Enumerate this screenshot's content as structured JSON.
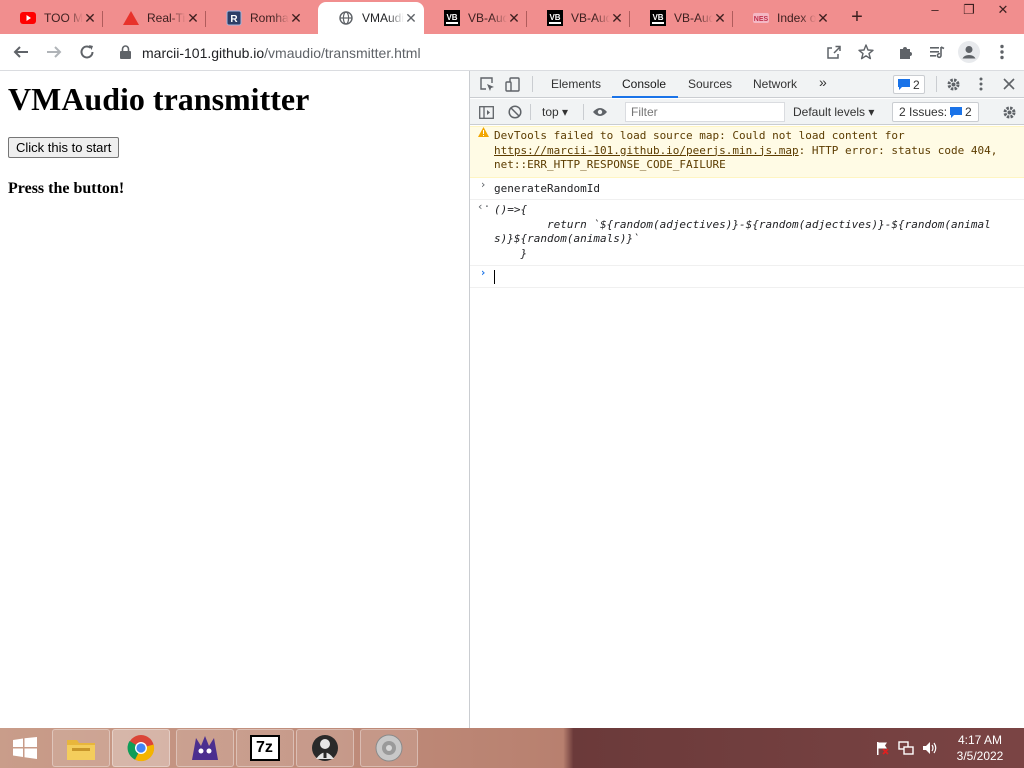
{
  "browser": {
    "tabs": [
      {
        "title": "TOO MUCH",
        "icon": "youtube-icon"
      },
      {
        "title": "Real-Time",
        "icon": "warning-triangle-icon"
      },
      {
        "title": "Romhacks",
        "icon": "r-logo-icon"
      },
      {
        "title": "VMAudio",
        "icon": "globe-icon",
        "active": true
      },
      {
        "title": "VB-Audio",
        "icon": "vb-audio-icon"
      },
      {
        "title": "VB-Audio",
        "icon": "vb-audio-icon"
      },
      {
        "title": "VB-Audio",
        "icon": "vb-audio-icon"
      },
      {
        "title": "Index of",
        "icon": "nes-icon"
      }
    ],
    "new_tab": "+",
    "window_controls": {
      "minimize": "–",
      "restore": "❐",
      "close": "✕"
    },
    "url_host": "marcii-101.github.io",
    "url_path": "/vmaudio/transmitter.html"
  },
  "page": {
    "heading": "VMAudio transmitter",
    "start_button": "Click this to start",
    "status": "Press the button!"
  },
  "devtools": {
    "tabs": [
      "Elements",
      "Console",
      "Sources",
      "Network"
    ],
    "active_tab": "Console",
    "more_tabs": "»",
    "messages_badge": "2",
    "context": "top",
    "filter_placeholder": "Filter",
    "levels": "Default levels",
    "issues_label": "2 Issues:",
    "issues_count": "2",
    "console": {
      "warning_prefix": "DevTools failed to load source map: Could not load content for ",
      "warning_link": "https://marcii-101.github.io/peerjs.min.js.map",
      "warning_suffix": ": HTTP error: status code 404, net::ERR_HTTP_RESPONSE_CODE_FAILURE",
      "command": "generateRandomId",
      "result": "()=>{\n        return `${random(adjectives)}-${random(adjectives)}-${random(animals)}${random(animals)}`\n    }"
    }
  },
  "taskbar": {
    "items": [
      "file-explorer-icon",
      "chrome-icon",
      "app-icon",
      "7zip-icon",
      "app-icon",
      "speaker-app-icon"
    ],
    "seven_zip_label": "7z",
    "time": "4:17 AM",
    "date": "3/5/2022"
  },
  "colors": {
    "tab_strip": "#f18e8e",
    "devtools_accent": "#1a73e8",
    "warning_bg": "#fffbe5"
  }
}
